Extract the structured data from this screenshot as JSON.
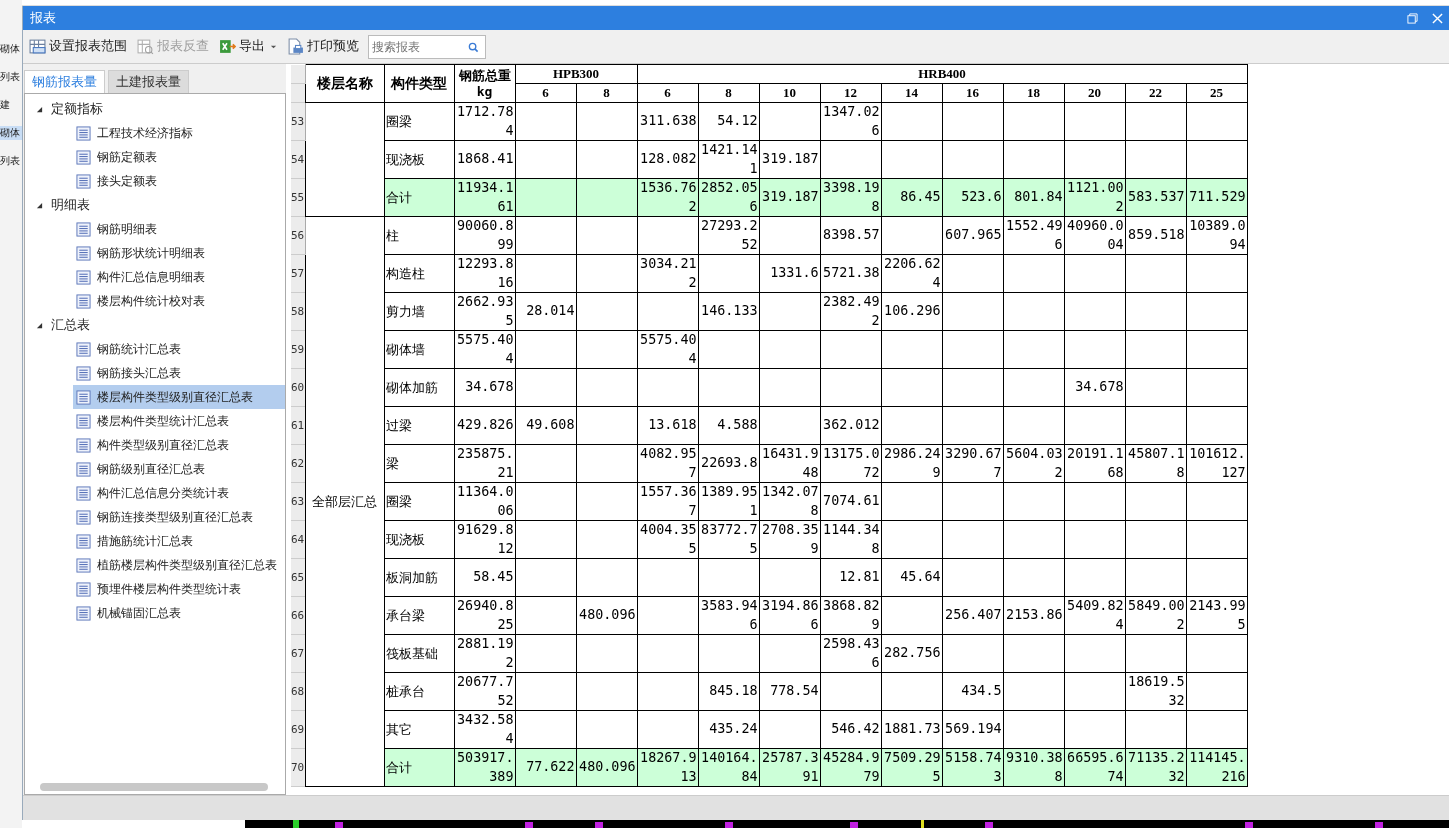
{
  "background_app": {
    "labels": [
      "砌体",
      "列表",
      "建",
      "砌体",
      "列表"
    ]
  },
  "window": {
    "title": "报表"
  },
  "toolbar": [
    {
      "label": "设置报表范围",
      "kind": "range",
      "disabled": false
    },
    {
      "label": "报表反查",
      "kind": "lookup",
      "disabled": true
    },
    {
      "label": "导出",
      "kind": "export",
      "disabled": false
    },
    {
      "label": "打印预览",
      "kind": "print",
      "disabled": false
    }
  ],
  "search": {
    "placeholder": "搜索报表"
  },
  "tabs": [
    {
      "label": "钢筋报表量",
      "selected": true
    },
    {
      "label": "土建报表量",
      "selected": false
    }
  ],
  "tree": [
    {
      "label": "定额指标",
      "expanded": true,
      "children": [
        {
          "label": "工程技术经济指标",
          "selected": false
        },
        {
          "label": "钢筋定额表",
          "selected": false
        },
        {
          "label": "接头定额表",
          "selected": false
        }
      ]
    },
    {
      "label": "明细表",
      "expanded": true,
      "children": [
        {
          "label": "钢筋明细表",
          "selected": false
        },
        {
          "label": "钢筋形状统计明细表",
          "selected": false
        },
        {
          "label": "构件汇总信息明细表",
          "selected": false
        },
        {
          "label": "楼层构件统计校对表",
          "selected": false
        }
      ]
    },
    {
      "label": "汇总表",
      "expanded": true,
      "children": [
        {
          "label": "钢筋统计汇总表",
          "selected": false
        },
        {
          "label": "钢筋接头汇总表",
          "selected": false
        },
        {
          "label": "楼层构件类型级别直径汇总表",
          "selected": true
        },
        {
          "label": "楼层构件类型统计汇总表",
          "selected": false
        },
        {
          "label": "构件类型级别直径汇总表",
          "selected": false
        },
        {
          "label": "钢筋级别直径汇总表",
          "selected": false
        },
        {
          "label": "构件汇总信息分类统计表",
          "selected": false
        },
        {
          "label": "钢筋连接类型级别直径汇总表",
          "selected": false
        },
        {
          "label": "措施筋统计汇总表",
          "selected": false
        },
        {
          "label": "植筋楼层构件类型级别直径汇总表",
          "selected": false
        },
        {
          "label": "预埋件楼层构件类型统计表",
          "selected": false
        },
        {
          "label": "机械锚固汇总表",
          "selected": false
        }
      ]
    }
  ],
  "table": {
    "headers": {
      "floor": "楼层名称",
      "type": "构件类型",
      "total": "钢筋总重kg"
    },
    "grades": [
      {
        "name": "HPB300",
        "diameters": [
          "6",
          "8"
        ]
      },
      {
        "name": "HRB400",
        "diameters": [
          "6",
          "8",
          "10",
          "12",
          "14",
          "16",
          "18",
          "20",
          "22",
          "25"
        ]
      }
    ],
    "groups": [
      {
        "rows": [
          {
            "num": "53",
            "kind": "item",
            "type": "圈梁",
            "total": "1712.784",
            "hrb400_6": "311.638",
            "hrb400_8": "54.12",
            "hrb400_12": "1347.026"
          },
          {
            "num": "54",
            "kind": "item",
            "type": "现浇板",
            "total": "1868.41",
            "hrb400_6": "128.082",
            "hrb400_8": "1421.141",
            "hrb400_10": "319.187"
          },
          {
            "num": "55",
            "kind": "subtotal",
            "type": "合计",
            "total": "11934.161",
            "hrb400_6": "1536.762",
            "hrb400_8": "2852.056",
            "hrb400_10": "319.187",
            "hrb400_12": "3398.198",
            "hrb400_14": "86.45",
            "hrb400_16": "523.6",
            "hrb400_18": "801.84",
            "hrb400_20": "1121.002",
            "hrb400_22": "583.537",
            "hrb400_25": "711.529"
          }
        ]
      },
      {
        "floor": "全部层汇总",
        "rows": [
          {
            "num": "56",
            "kind": "item",
            "type": "柱",
            "total": "90060.899",
            "hrb400_8": "27293.252",
            "hrb400_12": "8398.57",
            "hrb400_16": "607.965",
            "hrb400_18": "1552.496",
            "hrb400_20": "40960.004",
            "hrb400_22": "859.518",
            "hrb400_25": "10389.094"
          },
          {
            "num": "57",
            "kind": "item",
            "type": "构造柱",
            "total": "12293.816",
            "hrb400_6": "3034.212",
            "hrb400_10": "1331.6",
            "hrb400_12": "5721.38",
            "hrb400_14": "2206.624"
          },
          {
            "num": "58",
            "kind": "item",
            "type": "剪力墙",
            "total": "2662.935",
            "hpb300_6": "28.014",
            "hrb400_8": "146.133",
            "hrb400_12": "2382.492",
            "hrb400_14": "106.296"
          },
          {
            "num": "59",
            "kind": "item",
            "type": "砌体墙",
            "total": "5575.404",
            "hrb400_6": "5575.404"
          },
          {
            "num": "60",
            "kind": "item",
            "type": "砌体加筋",
            "total": "34.678",
            "hrb400_20": "34.678"
          },
          {
            "num": "61",
            "kind": "item",
            "type": "过梁",
            "total": "429.826",
            "hpb300_6": "49.608",
            "hrb400_6": "13.618",
            "hrb400_8": "4.588",
            "hrb400_12": "362.012"
          },
          {
            "num": "62",
            "kind": "item",
            "type": "梁",
            "total": "235875.21",
            "hrb400_6": "4082.957",
            "hrb400_8": "22693.8",
            "hrb400_10": "16431.948",
            "hrb400_12": "13175.072",
            "hrb400_14": "2986.249",
            "hrb400_16": "3290.677",
            "hrb400_18": "5604.032",
            "hrb400_20": "20191.168",
            "hrb400_22": "45807.18",
            "hrb400_25": "101612.127"
          },
          {
            "num": "63",
            "kind": "item",
            "type": "圈梁",
            "total": "11364.006",
            "hrb400_6": "1557.367",
            "hrb400_8": "1389.951",
            "hrb400_10": "1342.078",
            "hrb400_12": "7074.61"
          },
          {
            "num": "64",
            "kind": "item",
            "type": "现浇板",
            "total": "91629.812",
            "hrb400_6": "4004.355",
            "hrb400_8": "83772.75",
            "hrb400_10": "2708.359",
            "hrb400_12": "1144.348"
          },
          {
            "num": "65",
            "kind": "item",
            "type": "板洞加筋",
            "total": "58.45",
            "hrb400_12": "12.81",
            "hrb400_14": "45.64"
          },
          {
            "num": "66",
            "kind": "item",
            "type": "承台梁",
            "total": "26940.825",
            "hpb300_8": "480.096",
            "hrb400_8": "3583.946",
            "hrb400_10": "3194.866",
            "hrb400_12": "3868.829",
            "hrb400_16": "256.407",
            "hrb400_18": "2153.86",
            "hrb400_20": "5409.824",
            "hrb400_22": "5849.002",
            "hrb400_25": "2143.995"
          },
          {
            "num": "67",
            "kind": "item",
            "type": "筏板基础",
            "total": "2881.192",
            "hrb400_12": "2598.436",
            "hrb400_14": "282.756"
          },
          {
            "num": "68",
            "kind": "item",
            "type": "桩承台",
            "total": "20677.752",
            "hrb400_8": "845.18",
            "hrb400_10": "778.54",
            "hrb400_16": "434.5",
            "hrb400_22": "18619.532"
          },
          {
            "num": "69",
            "kind": "item",
            "type": "其它",
            "total": "3432.584",
            "hrb400_8": "435.24",
            "hrb400_12": "546.42",
            "hrb400_14": "1881.73",
            "hrb400_16": "569.194"
          },
          {
            "num": "70",
            "kind": "subtotal",
            "type": "合计",
            "total": "503917.389",
            "hpb300_6": "77.622",
            "hpb300_8": "480.096",
            "hrb400_6": "18267.913",
            "hrb400_8": "140164.84",
            "hrb400_10": "25787.391",
            "hrb400_12": "45284.979",
            "hrb400_14": "7509.295",
            "hrb400_16": "5158.743",
            "hrb400_18": "9310.388",
            "hrb400_20": "66595.674",
            "hrb400_22": "71135.232",
            "hrb400_25": "114145.216"
          }
        ]
      }
    ]
  }
}
